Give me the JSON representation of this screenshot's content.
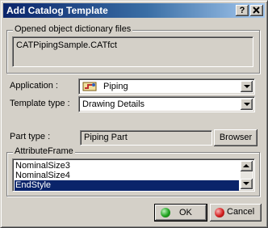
{
  "window": {
    "title": "Add Catalog Template",
    "help_button": "?",
    "close_button": "x"
  },
  "dictionary_group": {
    "label": "Opened object dictionary files",
    "files": [
      "CATPipingSample.CATfct"
    ]
  },
  "application": {
    "label": "Application :",
    "value": "Piping",
    "icon": "piping-icon"
  },
  "template_type": {
    "label": "Template type :",
    "value": "Drawing Details"
  },
  "part_type": {
    "label": "Part type :",
    "value": "Piping Part",
    "browser_label": "Browser"
  },
  "attribute_frame": {
    "label": "AttributeFrame",
    "items": [
      "NominalSize3",
      "NominalSize4",
      "EndStyle"
    ],
    "selected_index": 2
  },
  "buttons": {
    "ok_label": "OK",
    "cancel_label": "Cancel"
  },
  "colors": {
    "titlebar_start": "#0a246a",
    "titlebar_end": "#a6caf0",
    "selection": "#0a246a",
    "ok_orb": "#1fa31f",
    "cancel_orb": "#d42020"
  }
}
